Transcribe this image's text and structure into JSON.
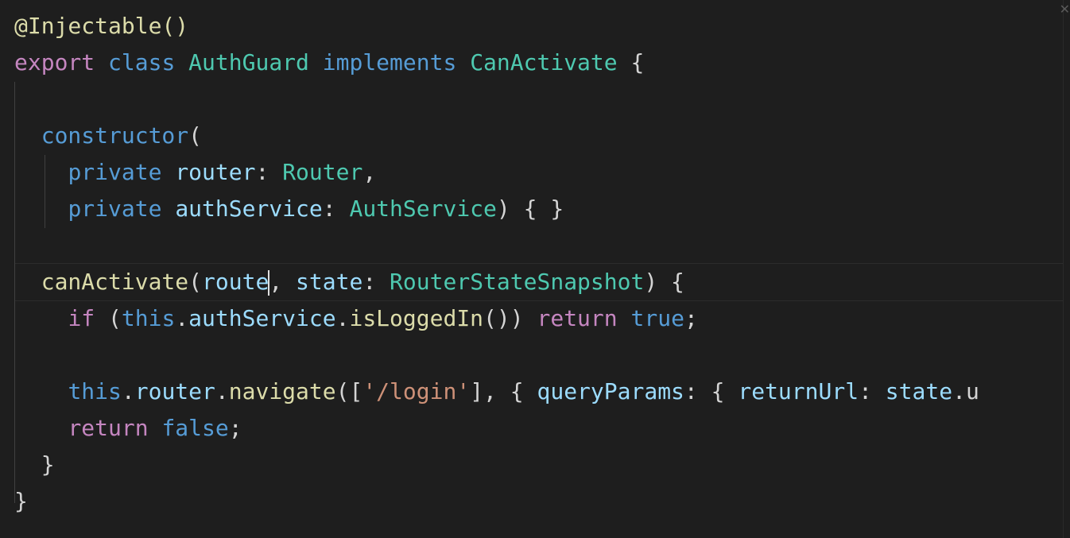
{
  "editor": {
    "language": "typescript",
    "cursor_line": 8,
    "close_icon_glyph": "✕",
    "lines": [
      {
        "tokens": [
          {
            "t": "@Injectable()",
            "c": "dec"
          }
        ]
      },
      {
        "tokens": [
          {
            "t": "export",
            "c": "ctrl"
          },
          {
            "t": " ",
            "c": "pun"
          },
          {
            "t": "class",
            "c": "kw"
          },
          {
            "t": " ",
            "c": "pun"
          },
          {
            "t": "AuthGuard",
            "c": "cls"
          },
          {
            "t": " ",
            "c": "pun"
          },
          {
            "t": "implements",
            "c": "kw"
          },
          {
            "t": " ",
            "c": "pun"
          },
          {
            "t": "CanActivate",
            "c": "cls"
          },
          {
            "t": " {",
            "c": "pun"
          }
        ]
      },
      {
        "tokens": []
      },
      {
        "tokens": [
          {
            "t": "  ",
            "c": "pun"
          },
          {
            "t": "constructor",
            "c": "kw"
          },
          {
            "t": "(",
            "c": "pun"
          }
        ]
      },
      {
        "tokens": [
          {
            "t": "    ",
            "c": "pun"
          },
          {
            "t": "private",
            "c": "kw"
          },
          {
            "t": " ",
            "c": "pun"
          },
          {
            "t": "router",
            "c": "var"
          },
          {
            "t": ": ",
            "c": "pun"
          },
          {
            "t": "Router",
            "c": "cls"
          },
          {
            "t": ",",
            "c": "pun"
          }
        ]
      },
      {
        "tokens": [
          {
            "t": "    ",
            "c": "pun"
          },
          {
            "t": "private",
            "c": "kw"
          },
          {
            "t": " ",
            "c": "pun"
          },
          {
            "t": "authService",
            "c": "var"
          },
          {
            "t": ": ",
            "c": "pun"
          },
          {
            "t": "AuthService",
            "c": "cls"
          },
          {
            "t": ") { }",
            "c": "pun"
          }
        ]
      },
      {
        "tokens": []
      },
      {
        "tokens": [
          {
            "t": "  ",
            "c": "pun"
          },
          {
            "t": "canActivate",
            "c": "fn"
          },
          {
            "t": "(",
            "c": "pun"
          },
          {
            "t": "route",
            "c": "var",
            "cursor_after": true
          },
          {
            "t": ", ",
            "c": "pun"
          },
          {
            "t": "state",
            "c": "var"
          },
          {
            "t": ": ",
            "c": "pun"
          },
          {
            "t": "RouterStateSnapshot",
            "c": "cls"
          },
          {
            "t": ") {",
            "c": "pun"
          }
        ]
      },
      {
        "tokens": [
          {
            "t": "    ",
            "c": "pun"
          },
          {
            "t": "if",
            "c": "ctrl"
          },
          {
            "t": " (",
            "c": "pun"
          },
          {
            "t": "this",
            "c": "kw"
          },
          {
            "t": ".",
            "c": "pun"
          },
          {
            "t": "authService",
            "c": "var"
          },
          {
            "t": ".",
            "c": "pun"
          },
          {
            "t": "isLoggedIn",
            "c": "fn"
          },
          {
            "t": "()) ",
            "c": "pun"
          },
          {
            "t": "return",
            "c": "ctrl"
          },
          {
            "t": " ",
            "c": "pun"
          },
          {
            "t": "true",
            "c": "bool"
          },
          {
            "t": ";",
            "c": "pun"
          }
        ]
      },
      {
        "tokens": []
      },
      {
        "tokens": [
          {
            "t": "    ",
            "c": "pun"
          },
          {
            "t": "this",
            "c": "kw"
          },
          {
            "t": ".",
            "c": "pun"
          },
          {
            "t": "router",
            "c": "var"
          },
          {
            "t": ".",
            "c": "pun"
          },
          {
            "t": "navigate",
            "c": "fn"
          },
          {
            "t": "([",
            "c": "pun"
          },
          {
            "t": "'/login'",
            "c": "str"
          },
          {
            "t": "], { ",
            "c": "pun"
          },
          {
            "t": "queryParams",
            "c": "var"
          },
          {
            "t": ": { ",
            "c": "pun"
          },
          {
            "t": "returnUrl",
            "c": "var"
          },
          {
            "t": ": ",
            "c": "pun"
          },
          {
            "t": "state",
            "c": "var"
          },
          {
            "t": ".u",
            "c": "pun"
          }
        ]
      },
      {
        "tokens": [
          {
            "t": "    ",
            "c": "pun"
          },
          {
            "t": "return",
            "c": "ctrl"
          },
          {
            "t": " ",
            "c": "pun"
          },
          {
            "t": "false",
            "c": "bool"
          },
          {
            "t": ";",
            "c": "pun"
          }
        ]
      },
      {
        "tokens": [
          {
            "t": "  }",
            "c": "pun"
          }
        ]
      },
      {
        "tokens": [
          {
            "t": "}",
            "c": "pun"
          }
        ]
      }
    ]
  }
}
